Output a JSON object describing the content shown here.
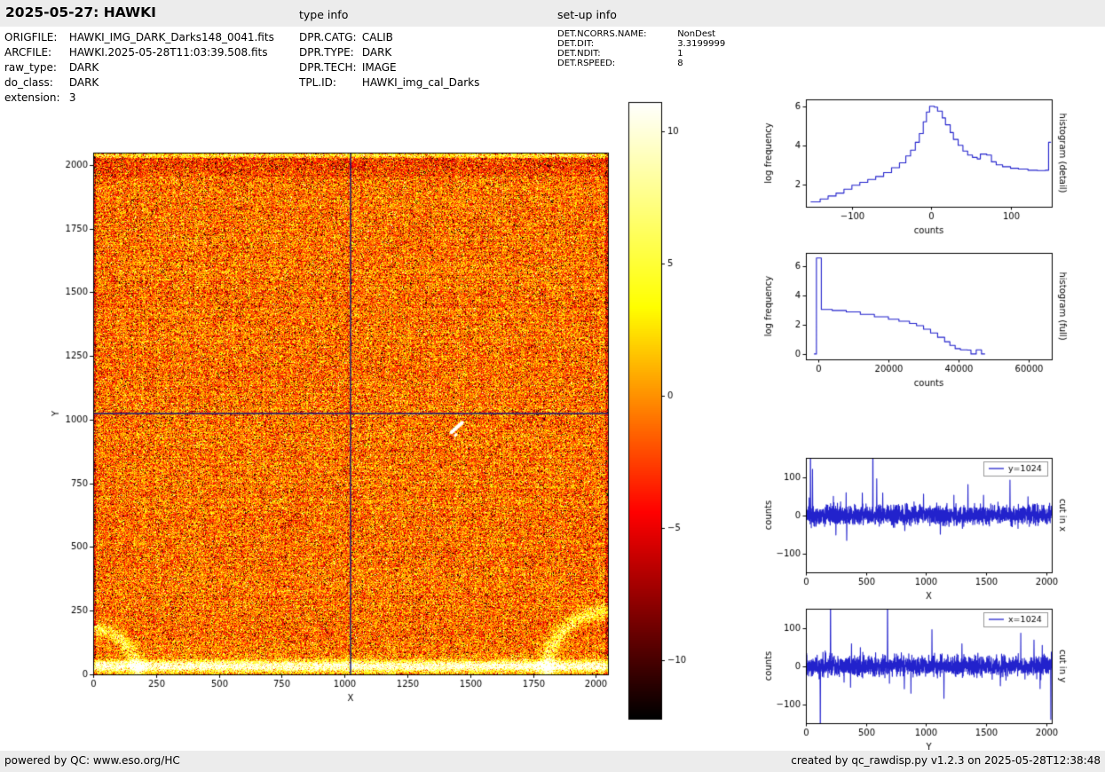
{
  "header": {
    "title": "2025-05-27: HAWKI",
    "type_info_label": "type info",
    "setup_info_label": "set-up info"
  },
  "file_info": {
    "rows": [
      {
        "label": "ORIGFILE:",
        "value": "HAWKI_IMG_DARK_Darks148_0041.fits"
      },
      {
        "label": "ARCFILE:",
        "value": "HAWKI.2025-05-28T11:03:39.508.fits"
      },
      {
        "label": "raw_type:",
        "value": "DARK"
      },
      {
        "label": "do_class:",
        "value": "DARK"
      },
      {
        "label": "extension:",
        "value": "3"
      }
    ]
  },
  "type_info": {
    "rows": [
      {
        "label": "DPR.CATG:",
        "value": "CALIB"
      },
      {
        "label": "DPR.TYPE:",
        "value": "DARK"
      },
      {
        "label": "DPR.TECH:",
        "value": "IMAGE"
      },
      {
        "label": "TPL.ID:",
        "value": "HAWKI_img_cal_Darks"
      }
    ]
  },
  "setup_info": {
    "rows": [
      {
        "label": "DET.NCORRS.NAME:",
        "value": "NonDest"
      },
      {
        "label": "DET.DIT:",
        "value": "3.3199999"
      },
      {
        "label": "DET.NDIT:",
        "value": "1"
      },
      {
        "label": "DET.RSPEED:",
        "value": "8"
      }
    ]
  },
  "footer": {
    "left": "powered by QC: www.eso.org/HC",
    "right": "created by qc_rawdisp.py v1.2.3 on 2025-05-28T12:38:48"
  },
  "colors": {
    "plot_line": "#2222cc",
    "crosshair": "#12127a",
    "header_footer_bg": "#ececec",
    "colormap": "hot"
  },
  "chart_data": [
    {
      "id": "main-image",
      "type": "heatmap",
      "xlabel": "X",
      "ylabel": "Y",
      "xlim": [
        0,
        2048
      ],
      "ylim": [
        0,
        2048
      ],
      "xticks": [
        0,
        250,
        500,
        750,
        1000,
        1250,
        1500,
        1750,
        2000
      ],
      "yticks": [
        0,
        250,
        500,
        750,
        1000,
        1250,
        1500,
        1750,
        2000
      ],
      "colormap": "hot",
      "image_size": 2048,
      "crosshair": {
        "x": 1024,
        "y": 1024
      },
      "noise": {
        "seed": 99,
        "mean": 0.5,
        "sigma": 0.11,
        "pepper": 0.13,
        "salt": 0.02
      },
      "margin": {
        "l": 65,
        "r": 25,
        "t": 27,
        "b": 50
      }
    },
    {
      "id": "colorbar",
      "type": "colorbar",
      "colormap": "hot",
      "vmin": -12.2,
      "vmax": 11.1,
      "ticks": [
        10,
        5,
        0,
        -5,
        -10
      ]
    },
    {
      "id": "hist-detail",
      "type": "line",
      "step": true,
      "xlabel": "counts",
      "ylabel": "log frequency",
      "right_label": "histogram (detail)",
      "xlim": [
        -158,
        152
      ],
      "ylim": [
        0.85,
        6.35
      ],
      "xticks": [
        -100,
        0,
        100
      ],
      "yticks": [
        2,
        4,
        6
      ],
      "margin": {
        "l": 58,
        "r": 30,
        "t": 17,
        "b": 47
      },
      "points": [
        [
          -152,
          1.1
        ],
        [
          -140,
          1.25
        ],
        [
          -130,
          1.4
        ],
        [
          -120,
          1.55
        ],
        [
          -110,
          1.75
        ],
        [
          -100,
          1.95
        ],
        [
          -90,
          2.1
        ],
        [
          -80,
          2.25
        ],
        [
          -70,
          2.4
        ],
        [
          -60,
          2.6
        ],
        [
          -50,
          2.85
        ],
        [
          -40,
          3.1
        ],
        [
          -32,
          3.45
        ],
        [
          -26,
          3.75
        ],
        [
          -20,
          4.15
        ],
        [
          -15,
          4.6
        ],
        [
          -10,
          5.2
        ],
        [
          -6,
          5.7
        ],
        [
          -2,
          6.0
        ],
        [
          4,
          5.95
        ],
        [
          8,
          5.75
        ],
        [
          14,
          5.4
        ],
        [
          18,
          5.05
        ],
        [
          24,
          4.65
        ],
        [
          28,
          4.3
        ],
        [
          34,
          4.0
        ],
        [
          40,
          3.7
        ],
        [
          46,
          3.5
        ],
        [
          52,
          3.38
        ],
        [
          58,
          3.3
        ],
        [
          62,
          3.55
        ],
        [
          70,
          3.5
        ],
        [
          76,
          3.15
        ],
        [
          82,
          3.0
        ],
        [
          90,
          2.9
        ],
        [
          100,
          2.82
        ],
        [
          110,
          2.78
        ],
        [
          122,
          2.72
        ],
        [
          134,
          2.7
        ],
        [
          144,
          2.72
        ],
        [
          148,
          4.15
        ],
        [
          151,
          4.15
        ]
      ]
    },
    {
      "id": "hist-full",
      "type": "line",
      "step": true,
      "xlabel": "counts",
      "ylabel": "log frequency",
      "right_label": "histogram (full)",
      "xlim": [
        -3500,
        66500
      ],
      "ylim": [
        -0.35,
        6.9
      ],
      "xticks": [
        0,
        20000,
        40000,
        60000
      ],
      "yticks": [
        0,
        2,
        4,
        6
      ],
      "margin": {
        "l": 58,
        "r": 30,
        "t": 15,
        "b": 50
      },
      "points": [
        [
          -1200,
          0.02
        ],
        [
          -500,
          6.55
        ],
        [
          900,
          3.05
        ],
        [
          4000,
          2.98
        ],
        [
          8000,
          2.88
        ],
        [
          12000,
          2.72
        ],
        [
          16000,
          2.55
        ],
        [
          20000,
          2.38
        ],
        [
          23000,
          2.25
        ],
        [
          26000,
          2.1
        ],
        [
          28000,
          1.95
        ],
        [
          30000,
          1.7
        ],
        [
          32000,
          1.45
        ],
        [
          34000,
          1.15
        ],
        [
          36000,
          0.85
        ],
        [
          37500,
          0.6
        ],
        [
          39000,
          0.38
        ],
        [
          40500,
          0.3
        ],
        [
          42500,
          0.28
        ],
        [
          43500,
          0.02
        ],
        [
          44500,
          0.02
        ],
        [
          45000,
          0.3
        ],
        [
          46500,
          0.02
        ],
        [
          47500,
          0.02
        ]
      ]
    },
    {
      "id": "cut-x",
      "type": "line",
      "xlabel": "X",
      "ylabel": "counts",
      "right_label": "cut in x",
      "legend": "y=1024",
      "xlim": [
        0,
        2048
      ],
      "ylim": [
        -150,
        150
      ],
      "xticks": [
        0,
        500,
        1000,
        1500,
        2000
      ],
      "yticks": [
        -100,
        0,
        100
      ],
      "margin": {
        "l": 58,
        "r": 30,
        "t": 16,
        "b": 40
      },
      "noise": {
        "seed": 11,
        "sigma": 12,
        "n": 2048
      },
      "spikes": [
        {
          "x": 38,
          "v": 210
        },
        {
          "x": 55,
          "v": 120
        },
        {
          "x": 250,
          "v": -52
        },
        {
          "x": 340,
          "v": -66
        },
        {
          "x": 470,
          "v": 58
        },
        {
          "x": 558,
          "v": 205
        },
        {
          "x": 590,
          "v": 95
        },
        {
          "x": 640,
          "v": 58
        },
        {
          "x": 980,
          "v": 55
        },
        {
          "x": 1120,
          "v": -50
        },
        {
          "x": 1350,
          "v": 80
        },
        {
          "x": 1480,
          "v": 52
        },
        {
          "x": 1700,
          "v": 92
        },
        {
          "x": 1850,
          "v": 48
        }
      ]
    },
    {
      "id": "cut-y",
      "type": "line",
      "xlabel": "Y",
      "ylabel": "counts",
      "right_label": "cut in y",
      "legend": "x=1024",
      "xlim": [
        0,
        2048
      ],
      "ylim": [
        -150,
        150
      ],
      "xticks": [
        0,
        500,
        1000,
        1500,
        2000
      ],
      "yticks": [
        -100,
        0,
        100
      ],
      "margin": {
        "l": 58,
        "r": 30,
        "t": 23,
        "b": 30
      },
      "noise": {
        "seed": 23,
        "sigma": 12,
        "n": 2048
      },
      "spikes": [
        {
          "x": 120,
          "v": -210
        },
        {
          "x": 205,
          "v": 205
        },
        {
          "x": 380,
          "v": 58
        },
        {
          "x": 680,
          "v": 205
        },
        {
          "x": 820,
          "v": -60
        },
        {
          "x": 1050,
          "v": 95
        },
        {
          "x": 1150,
          "v": -85
        },
        {
          "x": 1300,
          "v": 58
        },
        {
          "x": 1620,
          "v": -52
        },
        {
          "x": 1900,
          "v": 68
        },
        {
          "x": 2040,
          "v": -140
        }
      ]
    }
  ]
}
